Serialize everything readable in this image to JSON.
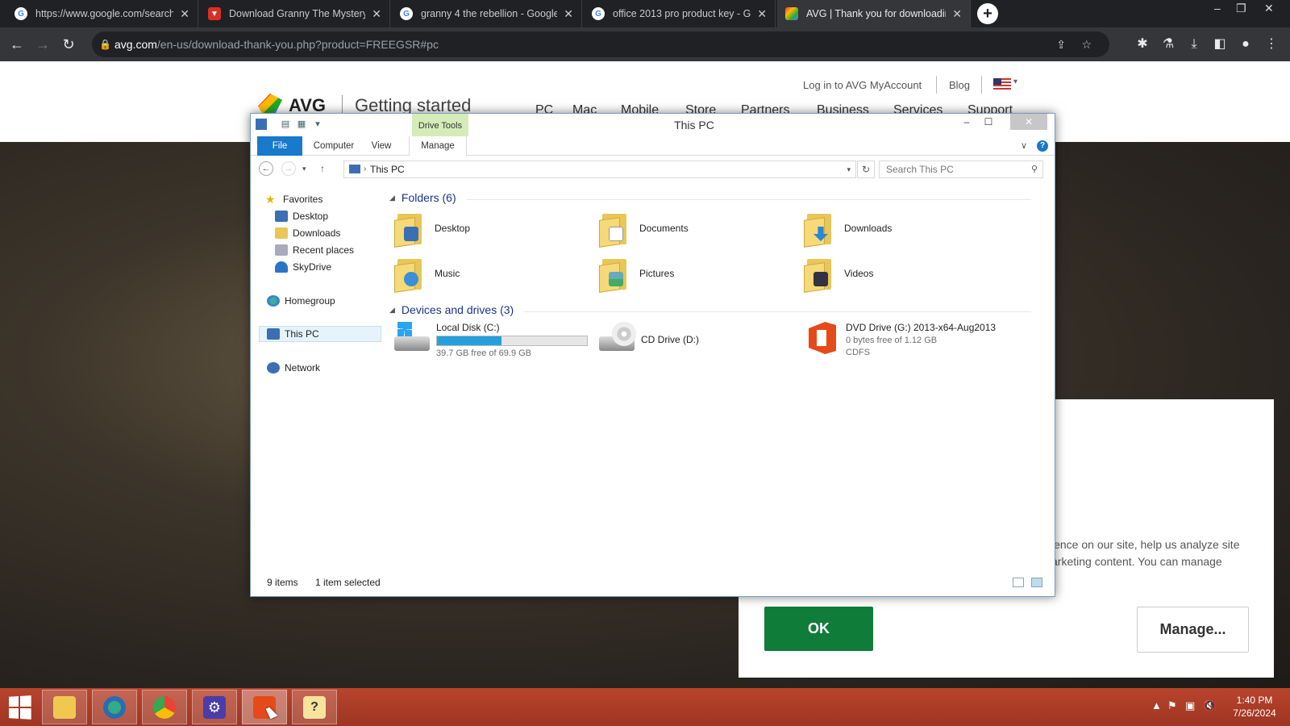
{
  "browser": {
    "tabs": [
      {
        "title": "https://www.google.com/search",
        "favicon": "google-icon"
      },
      {
        "title": "Download Granny The Mystery",
        "favicon": "download-site-icon"
      },
      {
        "title": "granny 4 the rebellion - Google",
        "favicon": "google-icon"
      },
      {
        "title": "office 2013 pro product key - G",
        "favicon": "google-icon"
      },
      {
        "title": "AVG | Thank you for downloadin",
        "favicon": "avg-icon",
        "active": true
      }
    ],
    "url_host": "avg.com",
    "url_path": "/en-us/download-thank-you.php?product=FREEGSR#pc"
  },
  "avg_page": {
    "brand": "AVG",
    "section": "Getting started",
    "login_link": "Log in to AVG MyAccount",
    "blog_link": "Blog",
    "menu": [
      "PC",
      "Mac",
      "Mobile",
      "Store",
      "Partners",
      "Business",
      "Services",
      "Support"
    ],
    "cookie_text": "ience on our site, help us analyze site arketing content. You can manage",
    "ok_label": "OK",
    "manage_label": "Manage..."
  },
  "explorer": {
    "title": "This PC",
    "drive_tools_label": "Drive Tools",
    "ribbon_tabs": [
      "File",
      "Computer",
      "View",
      "Manage"
    ],
    "address": "This PC",
    "search_placeholder": "Search This PC",
    "nav_pane": {
      "favorites": "Favorites",
      "favorite_items": [
        "Desktop",
        "Downloads",
        "Recent places",
        "SkyDrive"
      ],
      "homegroup": "Homegroup",
      "this_pc": "This PC",
      "network": "Network"
    },
    "folders_header": "Folders (6)",
    "folders": [
      "Desktop",
      "Documents",
      "Downloads",
      "Music",
      "Pictures",
      "Videos"
    ],
    "drives_header": "Devices and drives (3)",
    "drives": [
      {
        "name": "Local Disk (C:)",
        "free_text": "39.7 GB free of 69.9 GB",
        "used_fraction": 0.432
      },
      {
        "name": "CD Drive (D:)"
      },
      {
        "name": "DVD Drive (G:) 2013-x64-Aug2013",
        "free_text": "0 bytes free of 1.12 GB",
        "fs": "CDFS"
      }
    ],
    "status_items": "9 items",
    "status_selected": "1 item selected"
  },
  "taskbar": {
    "time": "1:40 PM",
    "date": "7/26/2024"
  }
}
